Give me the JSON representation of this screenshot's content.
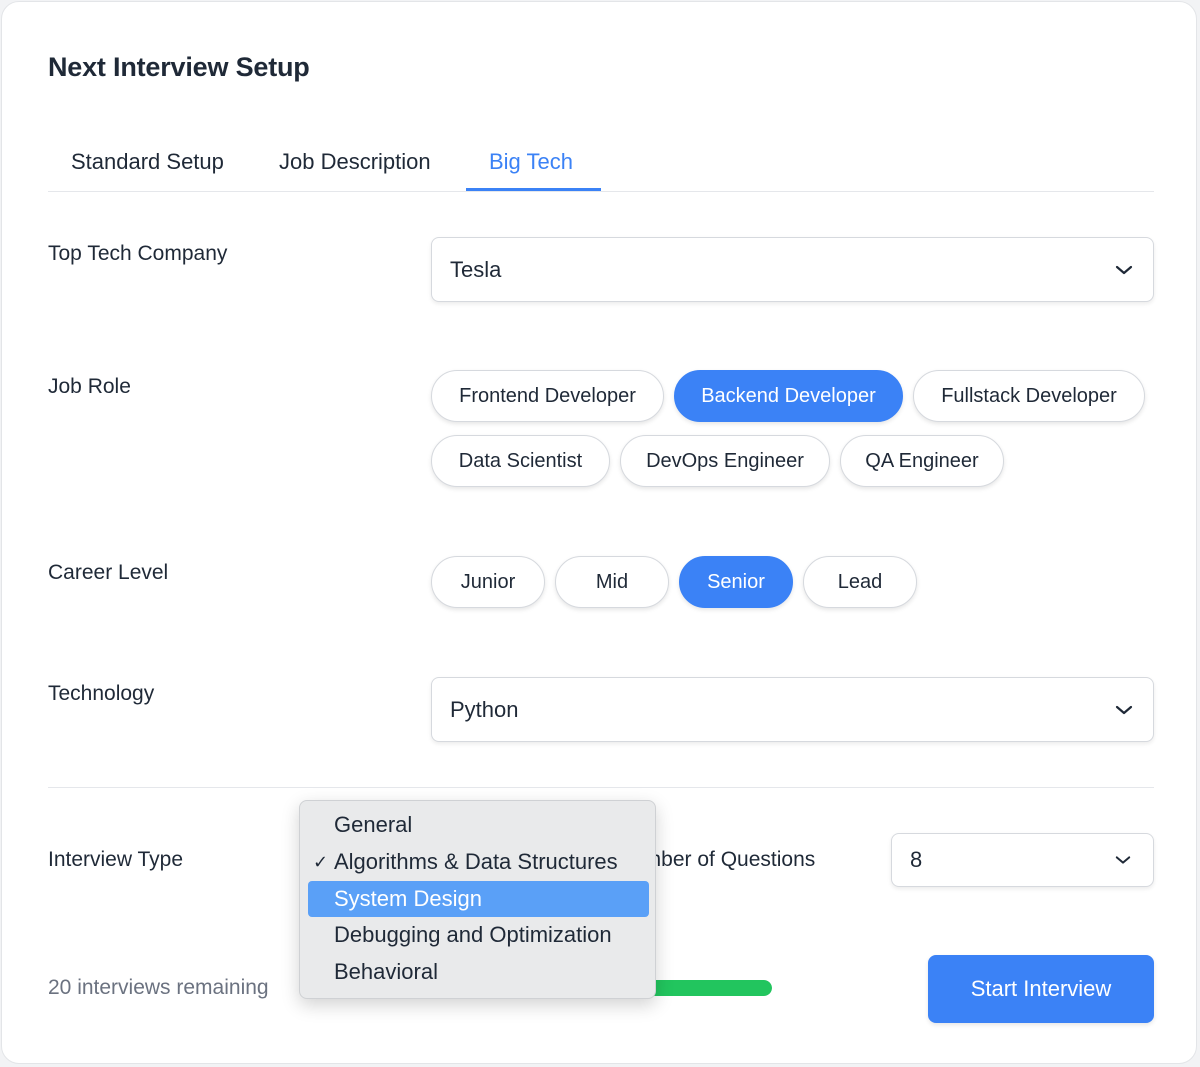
{
  "title": "Next Interview Setup",
  "tabs": [
    "Standard Setup",
    "Job Description",
    "Big Tech"
  ],
  "active_tab": "Big Tech",
  "company": {
    "label": "Top Tech Company",
    "value": "Tesla"
  },
  "job_role": {
    "label": "Job Role",
    "options": [
      "Frontend Developer",
      "Backend Developer",
      "Fullstack Developer",
      "Data Scientist",
      "DevOps Engineer",
      "QA Engineer"
    ],
    "selected": "Backend Developer"
  },
  "career_level": {
    "label": "Career Level",
    "options": [
      "Junior",
      "Mid",
      "Senior",
      "Lead"
    ],
    "selected": "Senior"
  },
  "technology": {
    "label": "Technology",
    "value": "Python"
  },
  "interview_type": {
    "label": "Interview Type",
    "options": [
      "General",
      "Algorithms & Data Structures",
      "System Design",
      "Debugging and Optimization",
      "Behavioral"
    ],
    "checked": "Algorithms & Data Structures",
    "highlighted": "System Design",
    "check_mark": "✓"
  },
  "questions": {
    "label_visible": "umber of Questions",
    "value": "8"
  },
  "footer": {
    "remaining_text": "20 interviews remaining",
    "progress_fraction": 1.0,
    "start_label": "Start Interview"
  },
  "colors": {
    "accent": "#3b82f6",
    "progress": "#22c55e",
    "menu_highlight": "#5aa0f7"
  },
  "icons": {
    "select_caret": "chevron-down-icon",
    "checked_option": "checkmark-icon"
  }
}
